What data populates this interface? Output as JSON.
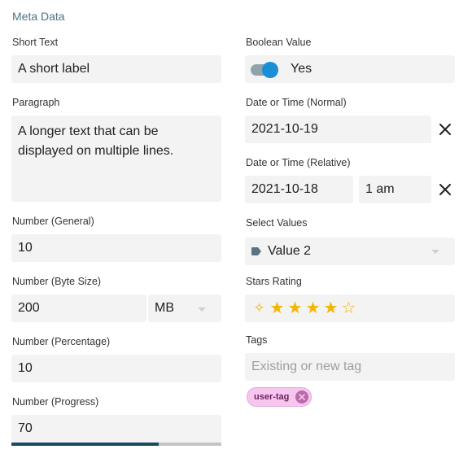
{
  "section_title": "Meta Data",
  "short_text": {
    "label": "Short Text",
    "value": "A short label"
  },
  "paragraph": {
    "label": "Paragraph",
    "value": "A longer text that can be displayed on multiple lines."
  },
  "number_general": {
    "label": "Number (General)",
    "value": "10"
  },
  "number_byte_size": {
    "label": "Number (Byte Size)",
    "value": "200",
    "unit": "MB"
  },
  "number_percentage": {
    "label": "Number (Percentage)",
    "value": "10"
  },
  "number_progress": {
    "label": "Number (Progress)",
    "value": "70",
    "progress_fraction": 0.7
  },
  "boolean_value": {
    "label": "Boolean Value",
    "value_text": "Yes",
    "checked": true
  },
  "date_normal": {
    "label": "Date or Time (Normal)",
    "value": "2021-10-19"
  },
  "date_relative": {
    "label": "Date or Time (Relative)",
    "date": "2021-10-18",
    "time": "1 am"
  },
  "select_values": {
    "label": "Select Values",
    "value": "Value 2"
  },
  "stars_rating": {
    "label": "Stars Rating",
    "rating": 4,
    "max": 5
  },
  "tags": {
    "label": "Tags",
    "placeholder": "Existing or new tag",
    "items": [
      "user-tag"
    ]
  },
  "icons": {
    "clear": "close-icon",
    "dropdown": "chevron-down-icon",
    "select_tag": "label-icon",
    "star_clear": "star-clear-icon",
    "star_filled": "star-icon",
    "star_empty": "star-outline-icon",
    "tag_remove": "remove-circle-icon"
  },
  "colors": {
    "accent": "#1a8ed6",
    "progress": "#194b5e",
    "star": "#f5b400",
    "tag_bg": "#f7c6ef",
    "section_title": "#4d7585"
  }
}
